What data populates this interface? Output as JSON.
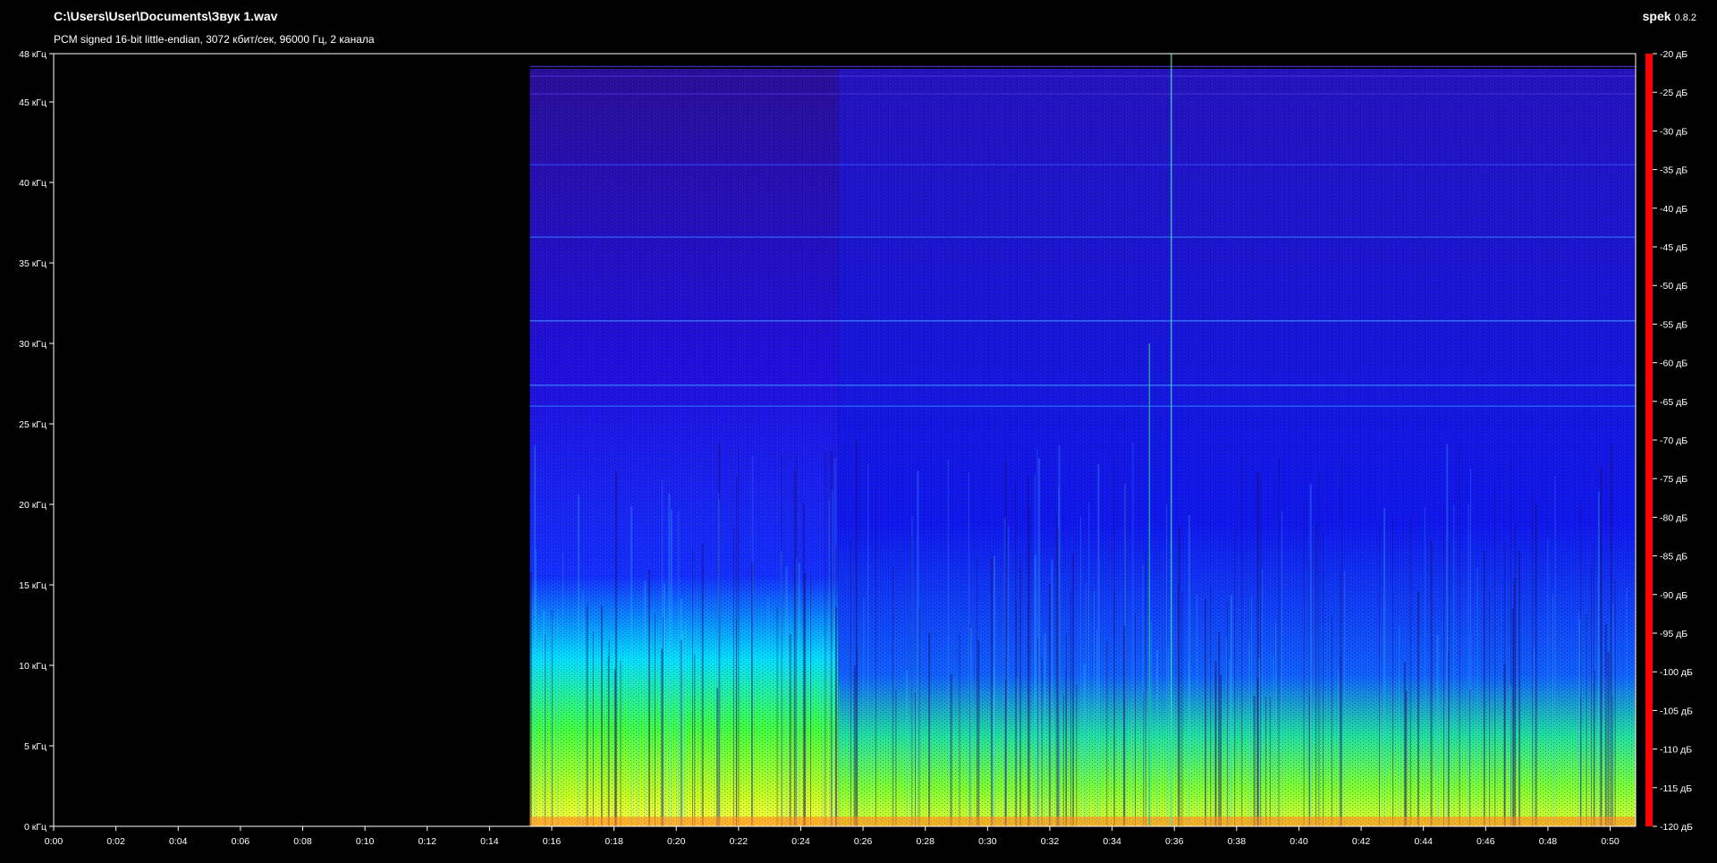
{
  "header": {
    "file_path": "C:\\Users\\User\\Documents\\Звук 1.wav",
    "stream_info": "PCM signed 16-bit little-endian, 3072 кбит/сек, 96000 Гц, 2 канала",
    "app_name": "spek",
    "app_version": "0.8.2"
  },
  "chart_data": {
    "type": "heatmap",
    "title": "C:\\Users\\User\\Documents\\Звук 1.wav",
    "subtitle": "PCM signed 16-bit little-endian, 3072 кбит/сек, 96000 Гц, 2 канала",
    "x_ticks": [
      "0:00",
      "0:02",
      "0:04",
      "0:06",
      "0:08",
      "0:10",
      "0:12",
      "0:14",
      "0:16",
      "0:18",
      "0:20",
      "0:22",
      "0:24",
      "0:26",
      "0:28",
      "0:30",
      "0:32",
      "0:34",
      "0:36",
      "0:38",
      "0:40",
      "0:42",
      "0:44",
      "0:46",
      "0:48",
      "0:50"
    ],
    "x_range_seconds": [
      0,
      51
    ],
    "y_ticks": [
      "0 кГц",
      "5 кГц",
      "10 кГц",
      "15 кГц",
      "20 кГц",
      "25 кГц",
      "30 кГц",
      "35 кГц",
      "40 кГц",
      "45 кГц",
      "48 кГц"
    ],
    "y_range_khz": [
      0,
      48
    ],
    "colorbar_ticks": [
      "-20 дБ",
      "-25 дБ",
      "-30 дБ",
      "-35 дБ",
      "-40 дБ",
      "-45 дБ",
      "-50 дБ",
      "-55 дБ",
      "-60 дБ",
      "-65 дБ",
      "-70 дБ",
      "-75 дБ",
      "-80 дБ",
      "-85 дБ",
      "-90 дБ",
      "-95 дБ",
      "-100 дБ",
      "-105 дБ",
      "-110 дБ",
      "-115 дБ",
      "-120 дБ"
    ],
    "colorbar_range_db": [
      -120,
      -20
    ],
    "silence_until_seconds": 15.3,
    "colorbar_colors": [
      "#ff0000",
      "#ff8800",
      "#ffff00",
      "#00ff00",
      "#00ffff",
      "#0000ff",
      "#4400aa",
      "#000000"
    ]
  }
}
